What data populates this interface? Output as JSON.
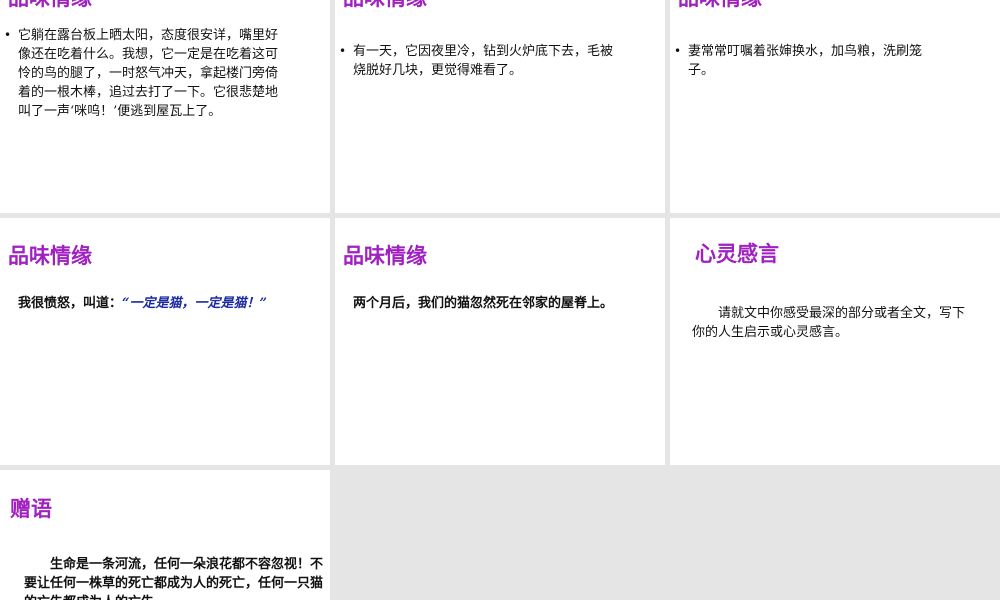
{
  "slides": [
    {
      "title": "品味情缘",
      "text": "它躺在露台板上晒太阳，态度很安详，嘴里好像还在吃着什么。我想，它一定是在吃着这可怜的鸟的腿了，一时怒气冲天，拿起楼门旁倚着的一根木棒，追过去打了一下。它很悲楚地叫了一声‘咪呜！’便逃到屋瓦上了。"
    },
    {
      "title": "品味情缘",
      "text": "有一天，它因夜里冷，钻到火炉底下去，毛被烧脱好几块，更觉得难看了。"
    },
    {
      "title": "品味情缘",
      "text": "妻常常叮嘱着张婶换水，加鸟粮，洗刷笼子。"
    },
    {
      "title": "品味情缘",
      "text_before": "我很愤怒，叫道：",
      "quote": "“一定是猫，一定是猫！”"
    },
    {
      "title": "品味情缘",
      "text": "两个月后，我们的猫忽然死在邻家的屋脊上。"
    },
    {
      "title": "心灵感言",
      "text": "请就文中你感受最深的部分或者全文，写下你的人生启示或心灵感言。"
    },
    {
      "title": "赠语",
      "text": "生命是一条河流，任何一朵浪花都不容忽视！不要让任何一株草的死亡都成为人的死亡，任何一只猫的亡失都成为人的亡失。"
    }
  ],
  "colors": {
    "title": "#a020c0",
    "quote": "#1a2aa0",
    "background": "#e5e5e5",
    "slide": "#ffffff"
  }
}
